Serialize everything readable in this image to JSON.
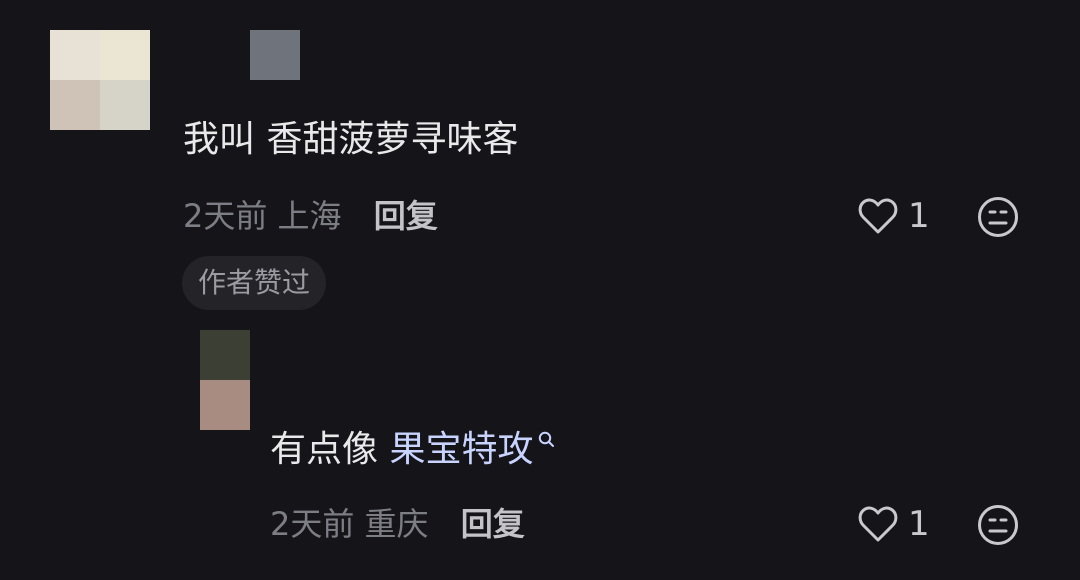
{
  "comment": {
    "text": "我叫 香甜菠萝寻味客",
    "time": "2天前",
    "location": "上海",
    "reply_label": "回复",
    "like_count": "1",
    "badge": "作者赞过"
  },
  "reply": {
    "text_prefix": "有点像 ",
    "link_text": "果宝特攻",
    "time": "2天前",
    "location": "重庆",
    "reply_label": "回复",
    "like_count": "1"
  },
  "icons": {
    "like": "heart-outline-icon",
    "emoji": "smiley-face-icon",
    "search": "search-small-icon"
  },
  "colors": {
    "background": "#151519",
    "text_primary": "#e9e9eb",
    "text_secondary": "#7d7d84",
    "link": "#c8d4ff",
    "badge_bg": "#232328"
  }
}
